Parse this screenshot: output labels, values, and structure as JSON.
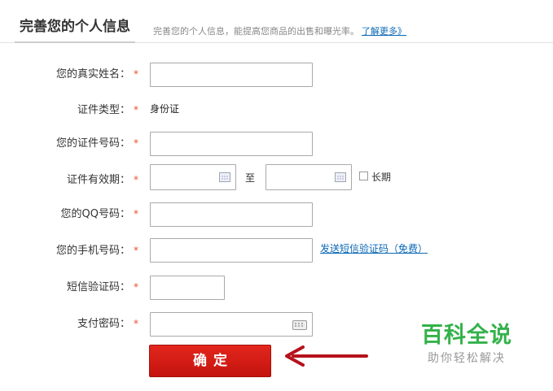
{
  "header": {
    "title": "完善您的个人信息",
    "description": "完善您的个人信息，能提高您商品的出售和曝光率。",
    "learn_more": "了解更多》"
  },
  "form": {
    "required_mark": "*",
    "fields": [
      {
        "label": "您的真实姓名：",
        "value": ""
      },
      {
        "label": "证件类型：",
        "value": "身份证"
      },
      {
        "label": "您的证件号码：",
        "value": ""
      },
      {
        "label": "证件有效期：",
        "start_value": "",
        "end_value": "",
        "separator": "至",
        "long_term_label": "长期",
        "long_term_checked": false
      },
      {
        "label": "您的QQ号码：",
        "value": ""
      },
      {
        "label": "您的手机号码：",
        "value": "",
        "action_link": "发送短信验证码（免费）"
      },
      {
        "label": "短信验证码：",
        "value": ""
      },
      {
        "label": "支付密码：",
        "value": ""
      }
    ],
    "submit_label": "确定"
  },
  "watermark": {
    "title": "百科全说",
    "subtitle": "助你轻松解决"
  },
  "colors": {
    "accent_red": "#c4140e",
    "link_blue": "#0b68b5",
    "required_orange": "#e8502c",
    "watermark_green": "#33b24a"
  }
}
